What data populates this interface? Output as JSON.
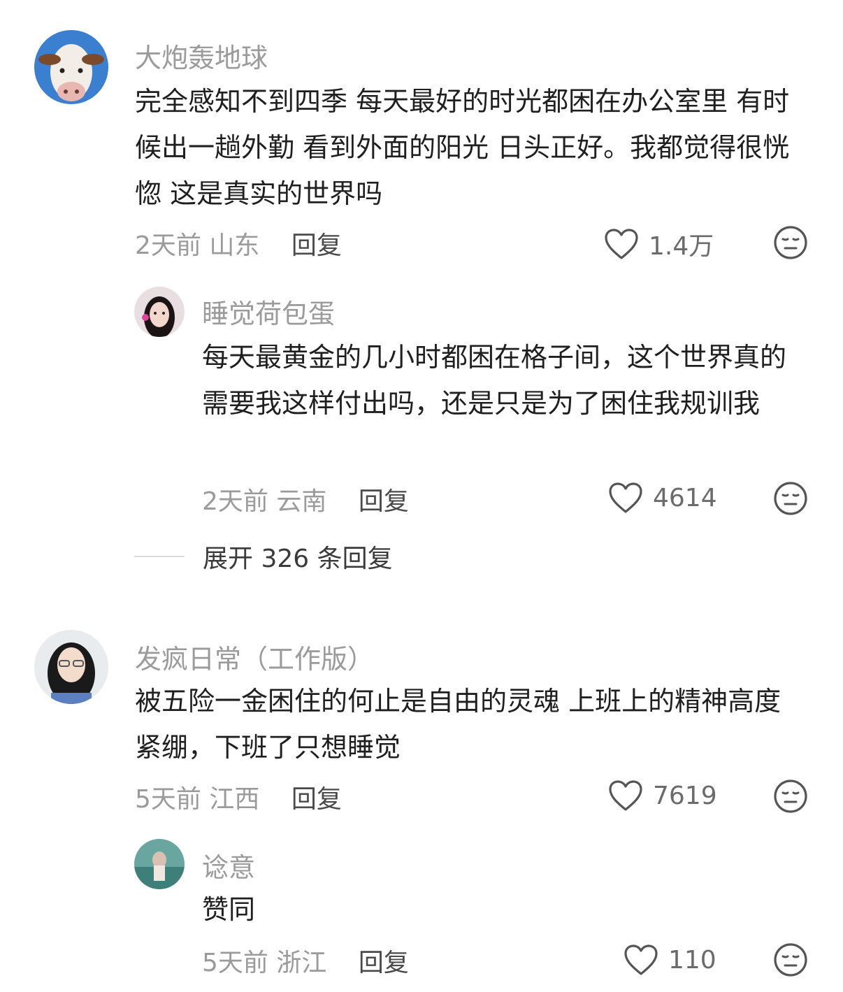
{
  "comments": [
    {
      "username": "大炮轰地球",
      "text": "完全感知不到四季 每天最好的时光都困在办公室里 有时候出一趟外勤 看到外面的阳光 日头正好。我都觉得很恍惚 这是真实的世界吗",
      "time": "2天前",
      "location": "山东",
      "reply_label": "回复",
      "likes": "1.4万",
      "replies": [
        {
          "username": "睡觉荷包蛋",
          "text": "每天最黄金的几小时都困在格子间，这个世界真的需要我这样付出吗，还是只是为了困住我规训我",
          "time": "2天前",
          "location": "云南",
          "reply_label": "回复",
          "likes": "4614"
        }
      ],
      "expand_label": "展开 326 条回复"
    },
    {
      "username": "发疯日常（工作版）",
      "text": "被五险一金困住的何止是自由的灵魂 上班上的精神高度紧绷，下班了只想睡觉",
      "time": "5天前",
      "location": "江西",
      "reply_label": "回复",
      "likes": "7619",
      "replies": [
        {
          "username": "谂意",
          "text": "赞同",
          "time": "5天前",
          "location": "浙江",
          "reply_label": "回复",
          "likes": "110"
        }
      ]
    }
  ],
  "icons": {
    "like": "heart-outline-icon",
    "dislike": "meh-face-icon"
  }
}
